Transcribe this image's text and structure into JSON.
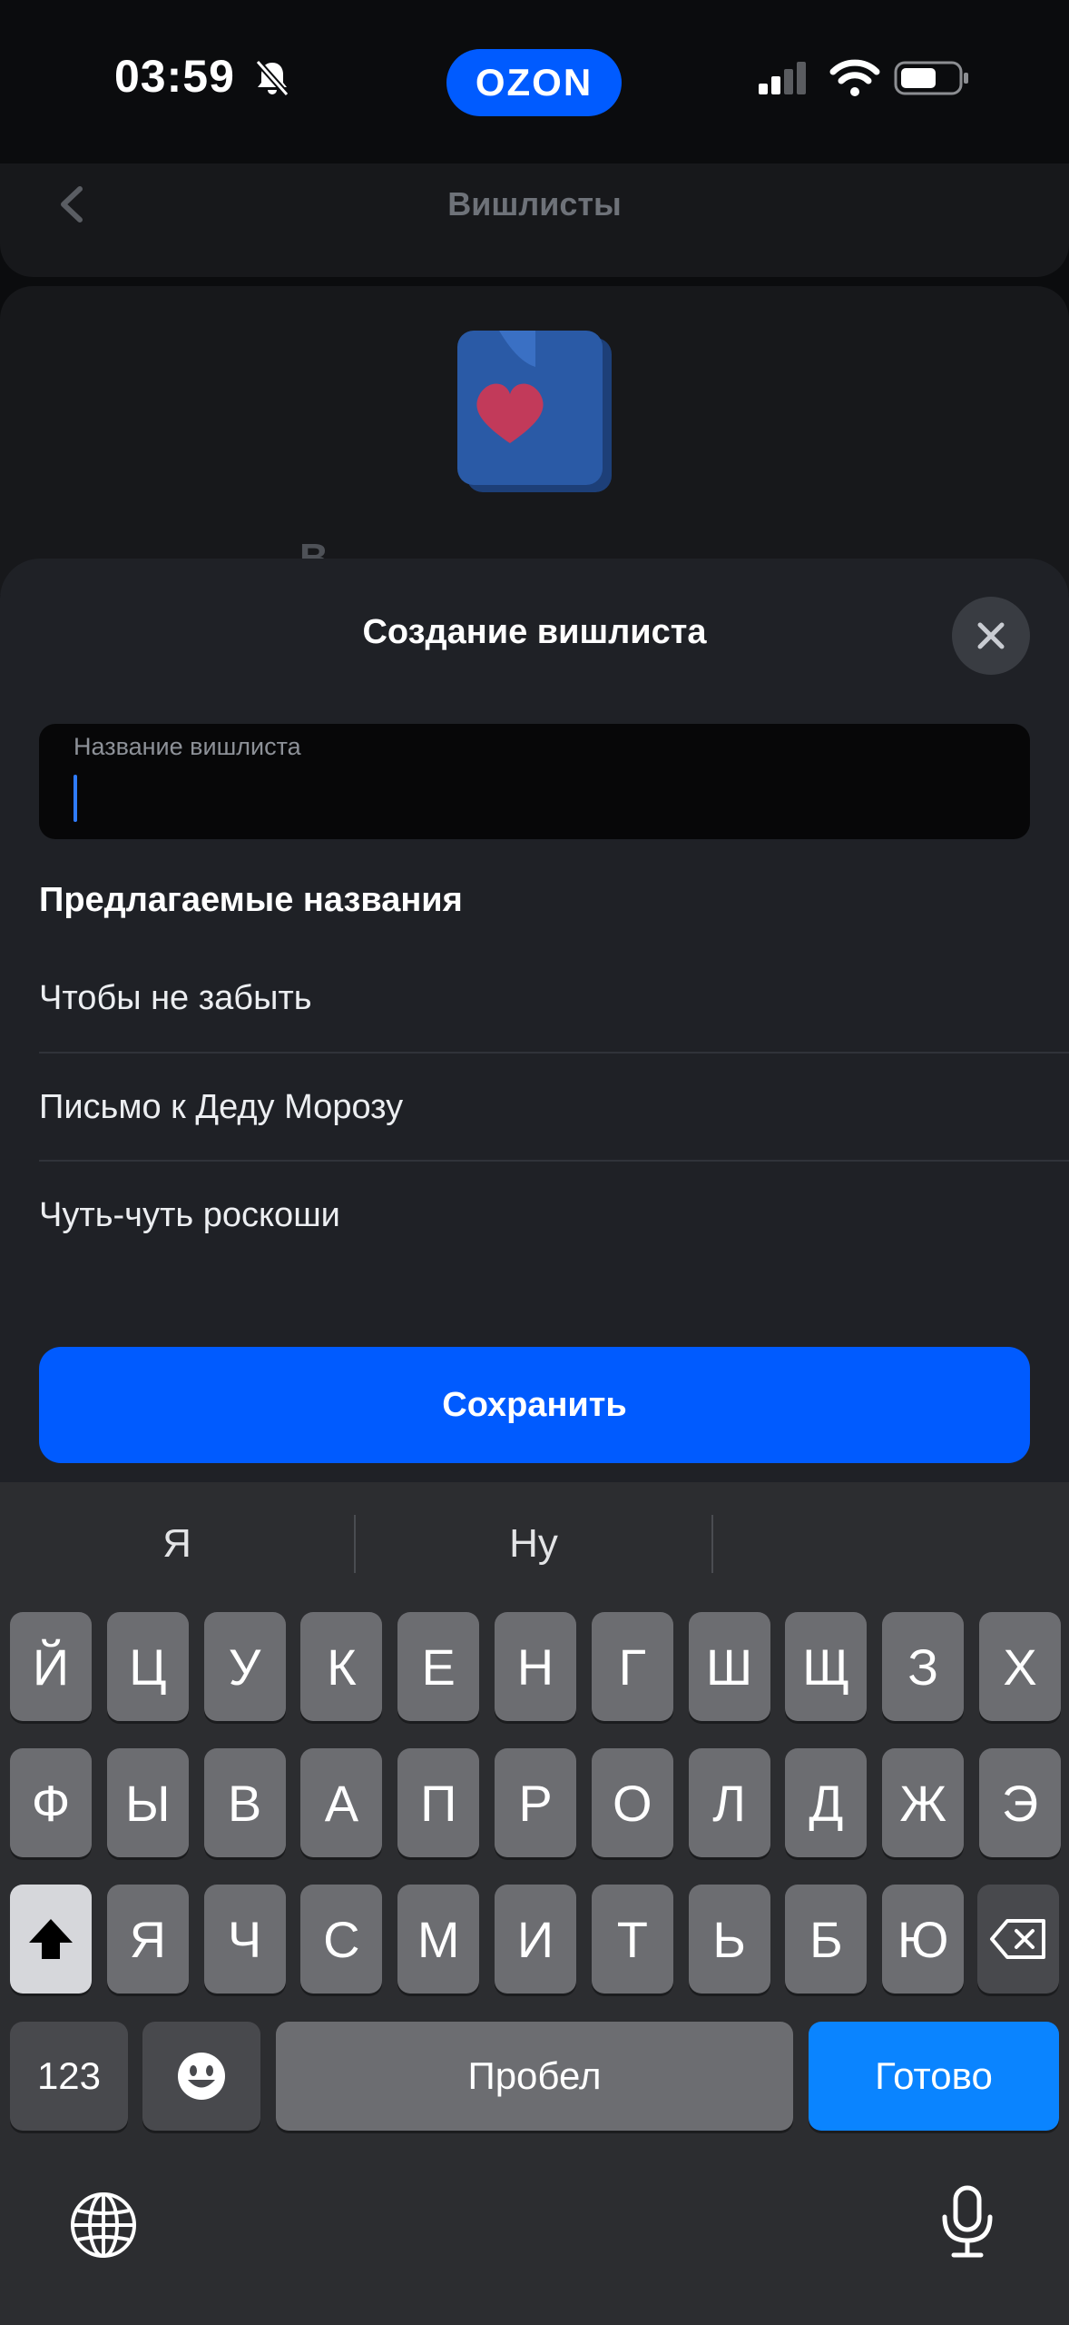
{
  "status_bar": {
    "time": "03:59",
    "brand": "OZON",
    "icons": [
      "bell-slash-icon",
      "cellular-signal-icon",
      "wifi-icon",
      "battery-icon"
    ]
  },
  "background": {
    "title": "Вишлисты",
    "partial_text": "В"
  },
  "sheet": {
    "title": "Создание вишлиста",
    "input_label": "Название вишлиста",
    "input_value": "",
    "suggested_title": "Предлагаемые названия",
    "suggestions": [
      "Чтобы не забыть",
      "Письмо к Деду Морозу",
      "Чуть-чуть роскоши"
    ],
    "save_label": "Сохранить"
  },
  "keyboard": {
    "predictions": [
      "Я",
      "Ну",
      ""
    ],
    "row1": [
      "Й",
      "Ц",
      "У",
      "К",
      "Е",
      "Н",
      "Г",
      "Ш",
      "Щ",
      "З",
      "Х"
    ],
    "row2": [
      "Ф",
      "Ы",
      "В",
      "А",
      "П",
      "Р",
      "О",
      "Л",
      "Д",
      "Ж",
      "Э"
    ],
    "row3": [
      "Я",
      "Ч",
      "С",
      "М",
      "И",
      "Т",
      "Ь",
      "Б",
      "Ю"
    ],
    "numbers_label": "123",
    "space_label": "Пробел",
    "done_label": "Готово"
  },
  "colors": {
    "accent": "#005bff",
    "sheet_bg": "#1f2126",
    "keyboard_bg": "#2c2d30",
    "done_key": "#0a84ff"
  }
}
